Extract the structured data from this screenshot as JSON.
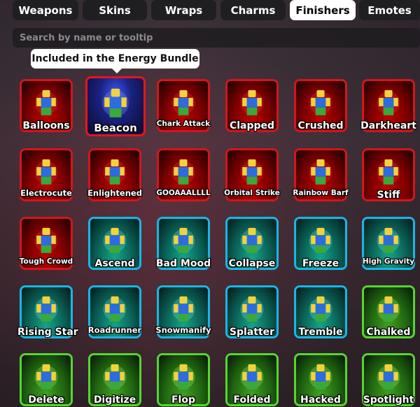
{
  "tabs": [
    {
      "label": "Weapons",
      "active": false
    },
    {
      "label": "Skins",
      "active": false
    },
    {
      "label": "Wraps",
      "active": false
    },
    {
      "label": "Charms",
      "active": false
    },
    {
      "label": "Finishers",
      "active": true
    },
    {
      "label": "Emotes",
      "active": false
    }
  ],
  "search": {
    "placeholder": "Search by name or tooltip",
    "value": ""
  },
  "tooltip": {
    "text": "Included in the Energy Bundle"
  },
  "colors": {
    "red": "#d2161b",
    "cyan": "#19b6e6",
    "green": "#58d432",
    "tab_active_bg": "#ffffff",
    "tab_bg": "#1f1f22"
  },
  "items": [
    {
      "name": "Balloons",
      "rarity": "red"
    },
    {
      "name": "Beacon",
      "rarity": "selected"
    },
    {
      "name": "Chark Attack",
      "rarity": "red"
    },
    {
      "name": "Clapped",
      "rarity": "red"
    },
    {
      "name": "Crushed",
      "rarity": "red"
    },
    {
      "name": "Darkheart",
      "rarity": "red"
    },
    {
      "name": "Electrocute",
      "rarity": "red"
    },
    {
      "name": "Enlightened",
      "rarity": "red"
    },
    {
      "name": "GOOAAALLLL",
      "rarity": "red"
    },
    {
      "name": "Orbital Strike",
      "rarity": "red"
    },
    {
      "name": "Rainbow Barf",
      "rarity": "red"
    },
    {
      "name": "Stiff",
      "rarity": "red"
    },
    {
      "name": "Tough Crowd",
      "rarity": "red"
    },
    {
      "name": "Ascend",
      "rarity": "cyan"
    },
    {
      "name": "Bad Mood",
      "rarity": "cyan"
    },
    {
      "name": "Collapse",
      "rarity": "cyan"
    },
    {
      "name": "Freeze",
      "rarity": "cyan"
    },
    {
      "name": "High Gravity",
      "rarity": "cyan"
    },
    {
      "name": "Rising Star",
      "rarity": "cyan"
    },
    {
      "name": "Roadrunner",
      "rarity": "cyan"
    },
    {
      "name": "Snowmanify",
      "rarity": "cyan"
    },
    {
      "name": "Splatter",
      "rarity": "cyan"
    },
    {
      "name": "Tremble",
      "rarity": "cyan"
    },
    {
      "name": "Chalked",
      "rarity": "green"
    },
    {
      "name": "Delete",
      "rarity": "green"
    },
    {
      "name": "Digitize",
      "rarity": "green"
    },
    {
      "name": "Flop",
      "rarity": "green"
    },
    {
      "name": "Folded",
      "rarity": "green"
    },
    {
      "name": "Hacked",
      "rarity": "green"
    },
    {
      "name": "Spotlight",
      "rarity": "green"
    }
  ]
}
